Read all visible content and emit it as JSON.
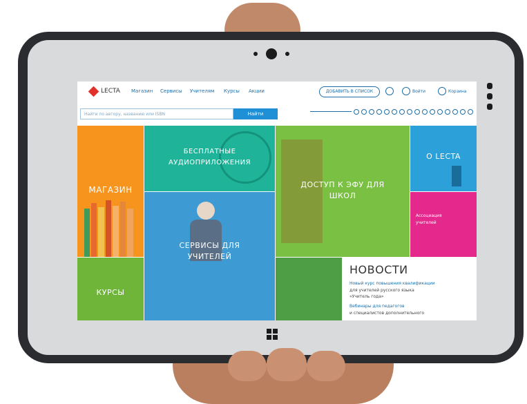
{
  "site": {
    "logo_text": "LECTA",
    "nav": [
      "Магазин",
      "Сервисы",
      "Учителям",
      "Курсы",
      "Акции"
    ],
    "pill_label": "ДОБАВИТЬ В СПИСОК",
    "login_label": "Войти",
    "cart_label": "Корзина",
    "search_placeholder": "Найти по автору, названию или ISBN",
    "search_button": "Найти"
  },
  "tiles": {
    "shop": "МАГАЗИН",
    "audio": "БЕСПЛАТНЫЕ АУДИОПРИЛОЖЕНИЯ",
    "efu": "ДОСТУП К ЭФУ ДЛЯ ШКОЛ",
    "about": "О LECTA",
    "promo": "Ассоциация учителей",
    "teachers": "СЕРВИСЫ ДЛЯ УЧИТЕЛЕЙ",
    "courses": "КУРСЫ"
  },
  "news": {
    "title": "НОВОСТИ",
    "items": [
      "Новый курс повышения квалификации",
      "для учителей русского языка",
      "«Учитель года»",
      "Вебинары для педагогов",
      "и специалистов дополнительного"
    ]
  },
  "colors": {
    "orange": "#f7941d",
    "teal": "#1fb39a",
    "green": "#7ac143",
    "blue": "#2ba0d9",
    "magenta": "#e5288c",
    "frame": "#2a2c2f"
  }
}
